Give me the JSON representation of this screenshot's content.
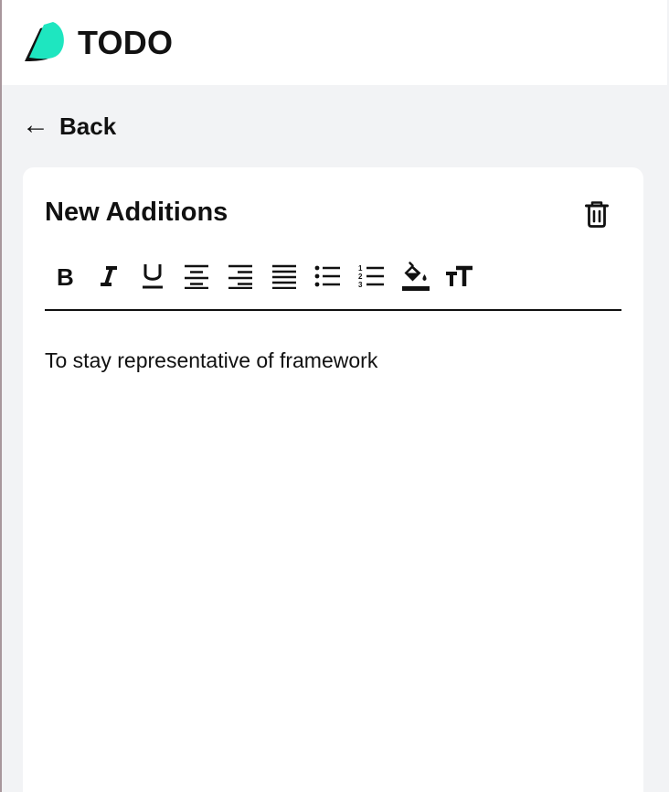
{
  "header": {
    "title": "TODO",
    "logo_icon": "todo-logo-icon",
    "accent": "#1ee6c0"
  },
  "nav": {
    "back_arrow": "←",
    "back_label": "Back"
  },
  "note": {
    "title": "New Additions",
    "delete_icon": "trash-icon",
    "body": "To stay representative of framework"
  },
  "toolbar": {
    "tools": [
      "bold-icon",
      "italic-icon",
      "underline-icon",
      "align-center-icon",
      "align-right-icon",
      "align-justify-icon",
      "bulleted-list-icon",
      "numbered-list-icon",
      "fill-color-icon",
      "text-size-icon"
    ]
  },
  "colors": {
    "page_background": "#f2f3f5",
    "card_background": "#ffffff",
    "text": "#111111"
  }
}
